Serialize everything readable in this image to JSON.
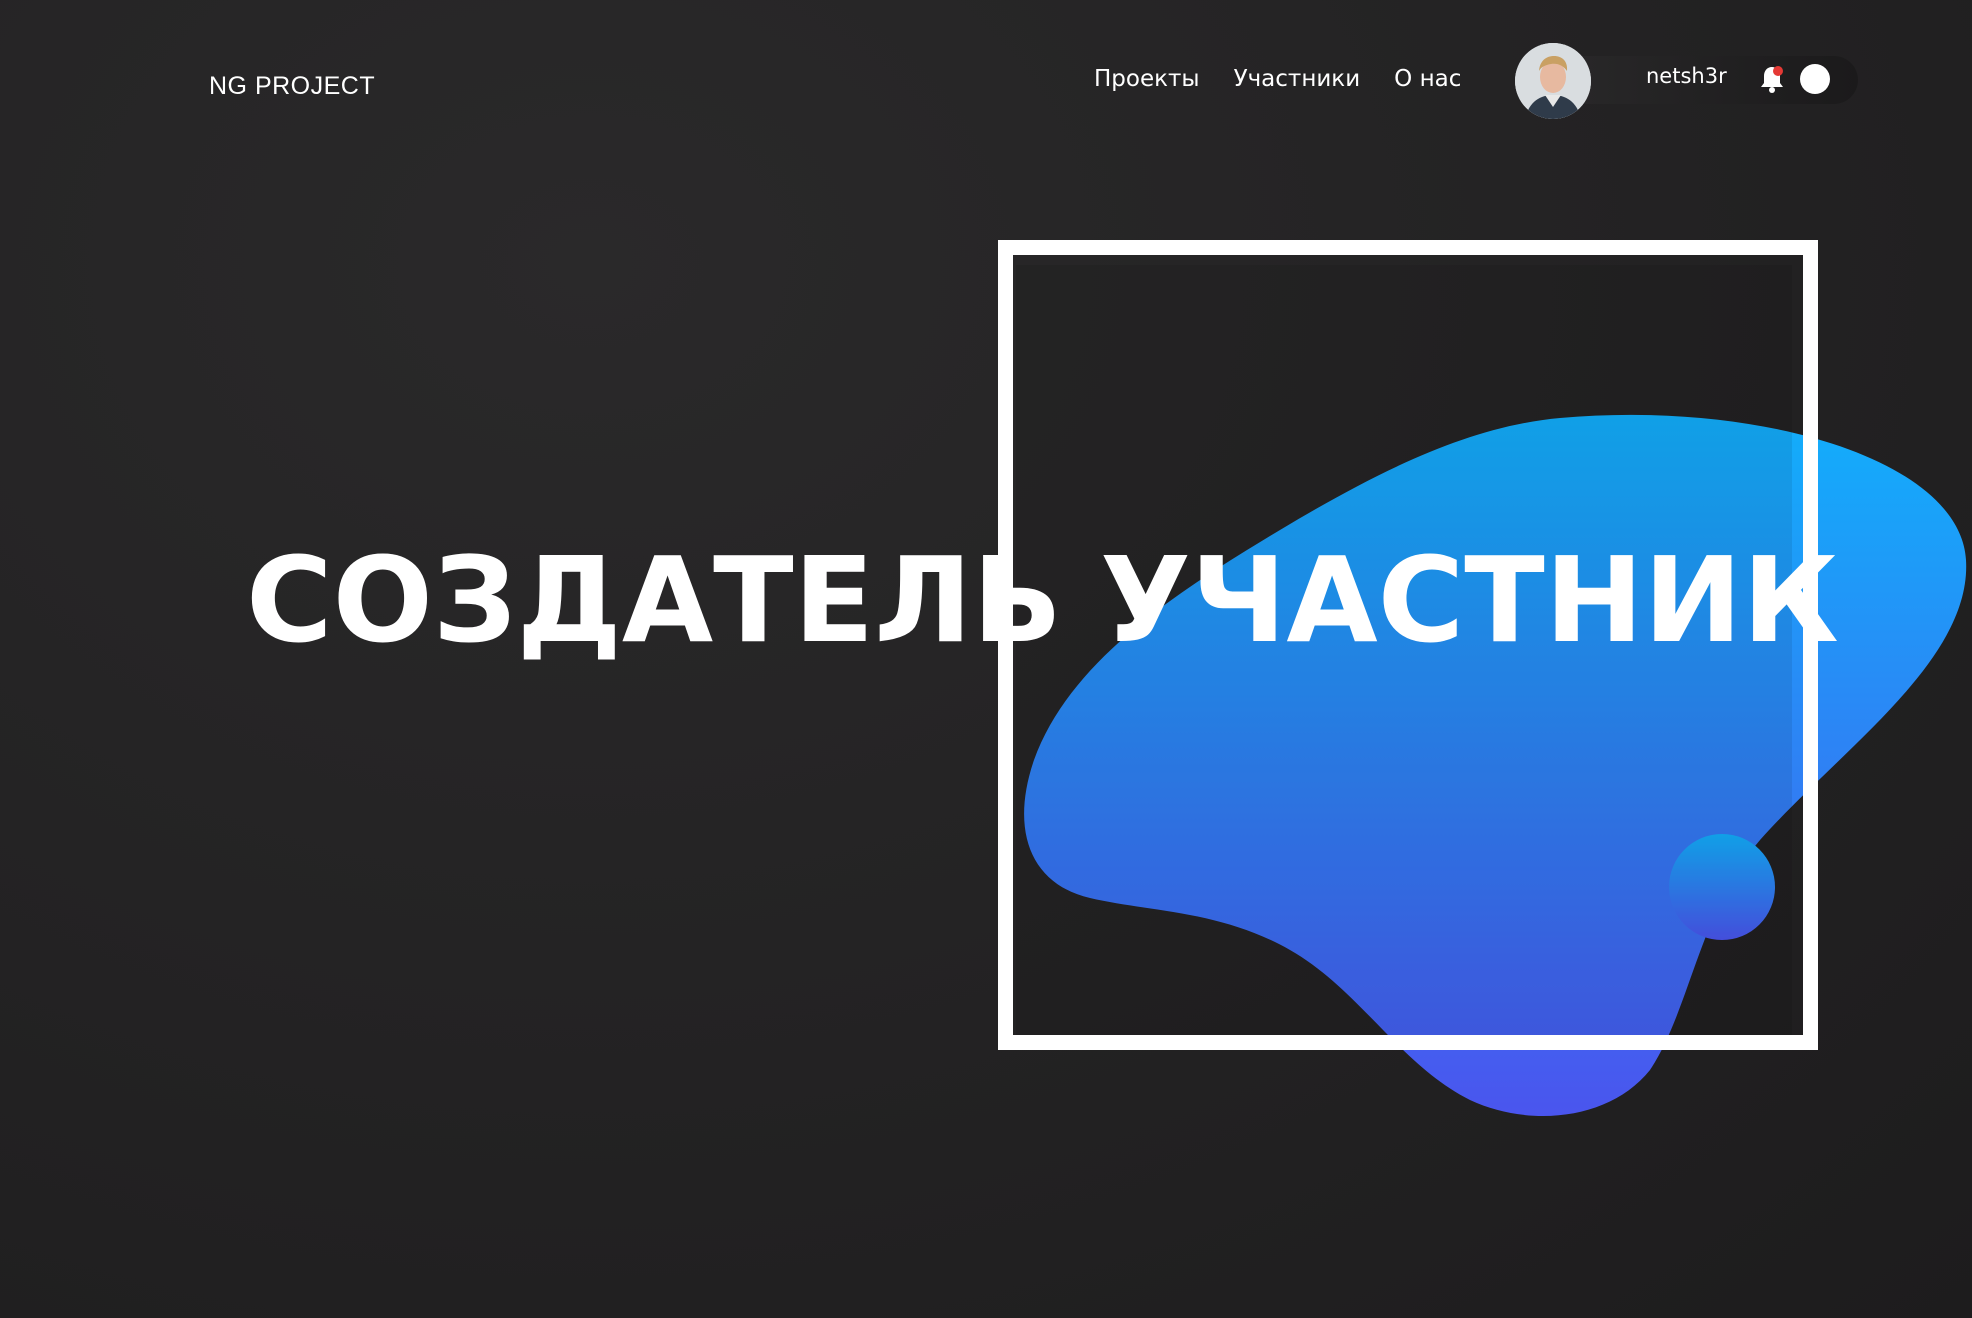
{
  "header": {
    "logo": "NG PROJECT",
    "nav": [
      {
        "label": "Проекты"
      },
      {
        "label": "Участники"
      },
      {
        "label": "О нас"
      }
    ],
    "user": {
      "username": "netsh3r",
      "notification_indicator_color": "#e53935"
    }
  },
  "hero": {
    "left_word": "СОЗДАТЕЛЬ",
    "right_word": "УЧАСТНИК"
  },
  "colors": {
    "background": "#232223",
    "text": "#ffffff",
    "blob_top": "#12aefb",
    "blob_bottom": "#4a55ee",
    "frame": "#ffffff"
  },
  "icons": [
    "avatar",
    "bell-icon",
    "toggle-knob"
  ]
}
